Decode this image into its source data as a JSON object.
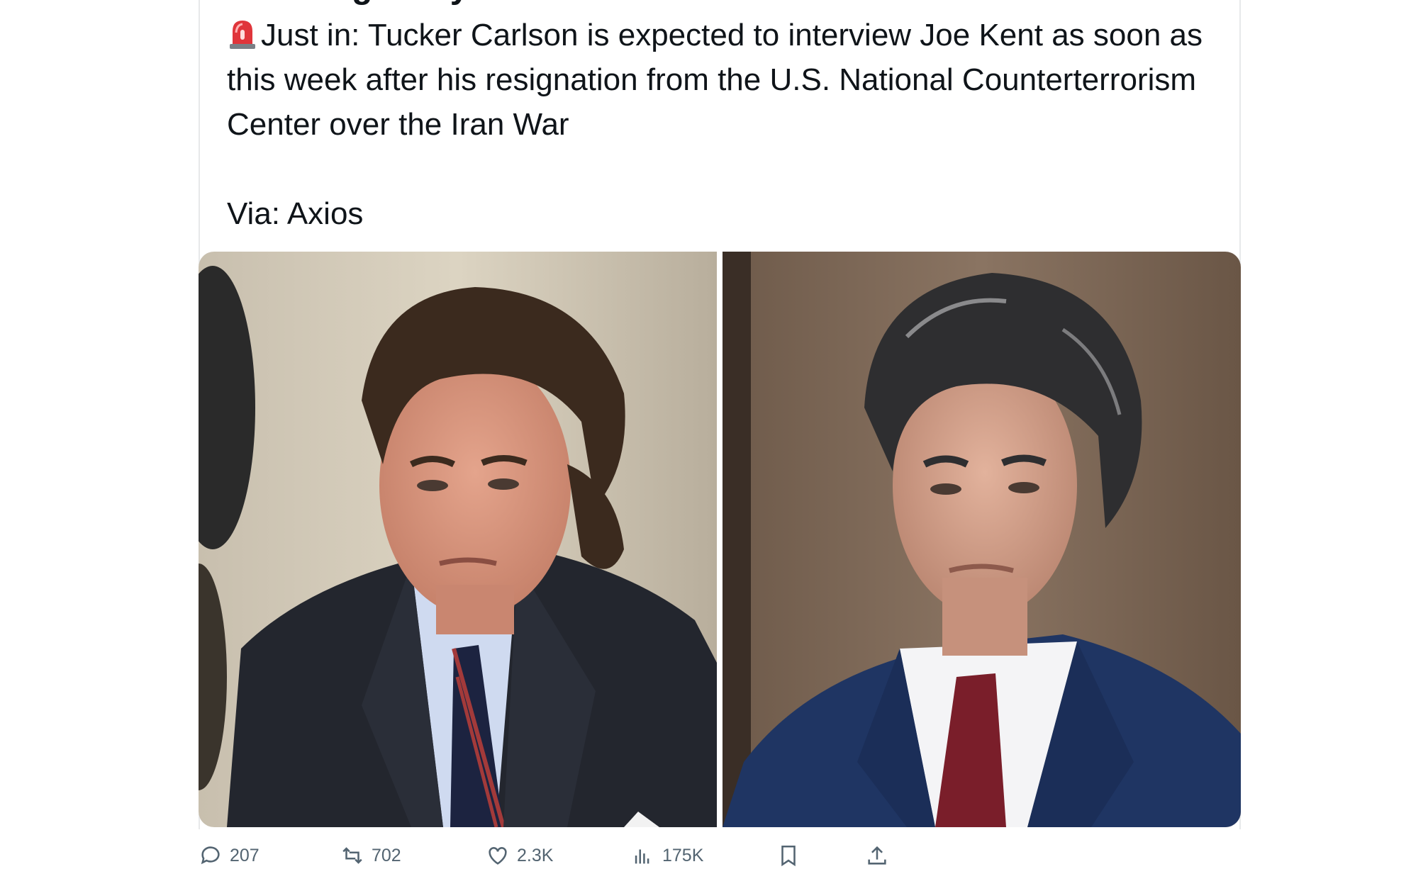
{
  "tweet": {
    "author_name_partial": "Breaking Story",
    "text_lines": [
      "Just in: Tucker Carlson is expected to interview Joe Kent as soon as",
      "this week after his resignation from the U.S. National Counterterrorism",
      "Center over the Iran War"
    ],
    "source_line": "Via: Axios",
    "lead_emoji": "siren-icon"
  },
  "media": {
    "images": [
      {
        "name": "photo-tucker-carlson",
        "subject": "man in dark suit, light blue checked shirt, striped tie"
      },
      {
        "name": "photo-joe-kent",
        "subject": "man in navy suit, white shirt, maroon tie"
      }
    ]
  },
  "actions": {
    "replies": "207",
    "reposts": "702",
    "likes": "2.3K",
    "views": "175K",
    "bookmark_icon": "bookmark-icon",
    "share_icon": "share-icon"
  },
  "colors": {
    "text": "#0f1419",
    "muted": "#536471",
    "border": "#e7e9ea"
  }
}
